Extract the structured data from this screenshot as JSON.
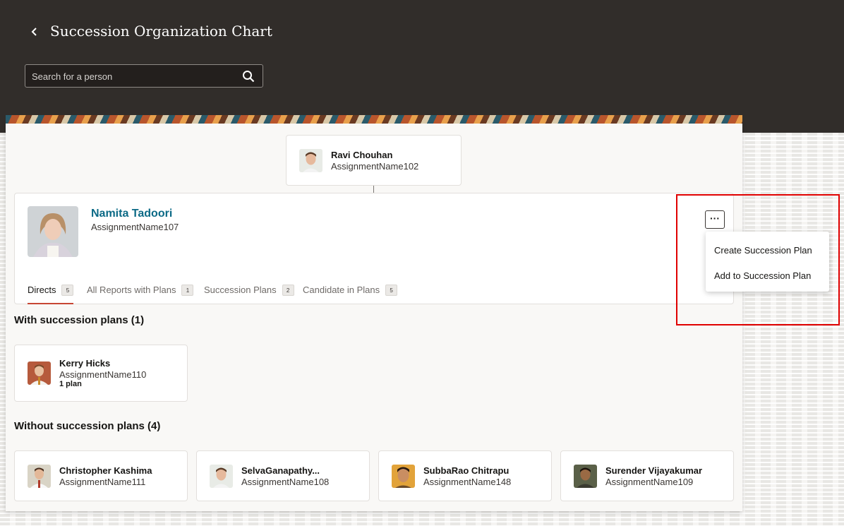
{
  "header": {
    "back_icon": "chevron-left-icon",
    "title": "Succession Organization Chart",
    "search": {
      "placeholder": "Search for a person",
      "icon": "search-icon"
    }
  },
  "manager": {
    "name": "Ravi Chouhan",
    "assignment": "AssignmentName102"
  },
  "focus": {
    "name": "Namita Tadoori",
    "assignment": "AssignmentName107",
    "more_label": "···",
    "tabs": [
      {
        "label": "Directs",
        "count": "5",
        "active": true
      },
      {
        "label": "All Reports with Plans",
        "count": "1"
      },
      {
        "label": "Succession Plans",
        "count": "2"
      },
      {
        "label": "Candidate in Plans",
        "count": "5"
      }
    ]
  },
  "actions_menu": {
    "items": [
      {
        "label": "Create Succession Plan"
      },
      {
        "label": "Add to Succession Plan"
      }
    ]
  },
  "with_plans": {
    "title": "With succession plans (1)",
    "people": [
      {
        "name": "Kerry Hicks",
        "assignment": "AssignmentName110",
        "plans": "1 plan"
      }
    ]
  },
  "without_plans": {
    "title": "Without succession plans (4)",
    "people": [
      {
        "name": "Christopher Kashima",
        "assignment": "AssignmentName111"
      },
      {
        "name": "SelvaGanapathy...",
        "assignment": "AssignmentName108"
      },
      {
        "name": "SubbaRao Chitrapu",
        "assignment": "AssignmentName148"
      },
      {
        "name": "Surender Vijayakumar",
        "assignment": "AssignmentName109"
      }
    ]
  },
  "colors": {
    "header_bg": "#312d2a",
    "link": "#0c6a86",
    "tab_accent": "#c74634",
    "highlight": "#e00000"
  }
}
